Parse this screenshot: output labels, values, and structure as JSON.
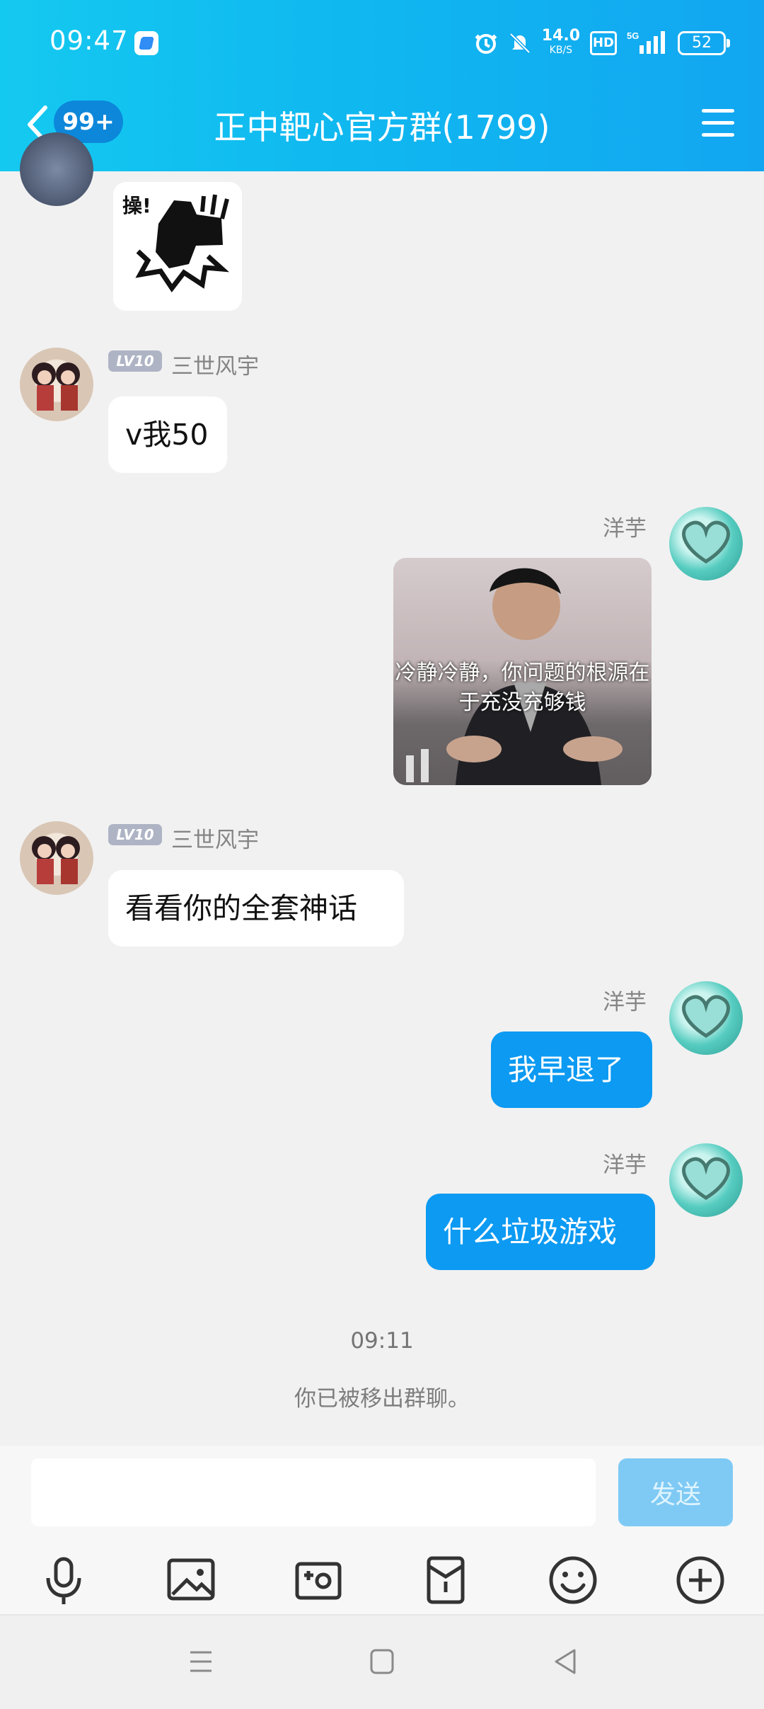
{
  "status": {
    "time": "09:47",
    "speed": "14.0",
    "speed_unit": "KB/S",
    "hd": "HD",
    "network": "5G",
    "battery": "52"
  },
  "header": {
    "badge": "99+",
    "title": "正中靶心官方群(1799)"
  },
  "messages": [
    {
      "sticker_text": "操!"
    },
    {
      "level": "LV10",
      "name": "三世风宇",
      "text": "v我50"
    },
    {
      "name": "洋芋",
      "meme_text": "冷静冷静，你问题的根源在于充没充够钱"
    },
    {
      "level": "LV10",
      "name": "三世风宇",
      "text": "看看你的全套神话"
    },
    {
      "name": "洋芋",
      "text": "我早退了"
    },
    {
      "name": "洋芋",
      "text": "什么垃圾游戏"
    }
  ],
  "system": {
    "time": "09:11",
    "notice": "你已被移出群聊。"
  },
  "composer": {
    "placeholder": "",
    "send_label": "发送"
  },
  "icons": [
    "microphone-icon",
    "image-icon",
    "camera-icon",
    "red-packet-icon",
    "emoji-icon",
    "plus-icon"
  ],
  "colors": {
    "header": "#12b8f0",
    "outgoing_bubble": "#0c9af2",
    "send_disabled": "#7fcaf4"
  }
}
